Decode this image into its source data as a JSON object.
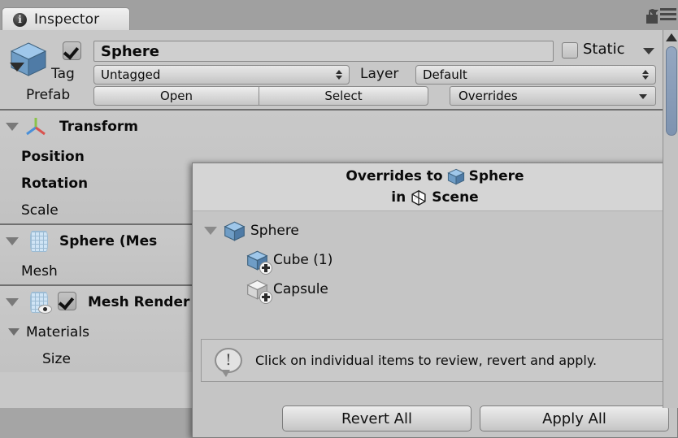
{
  "window": {
    "tab_label": "Inspector",
    "tab_icon": "info-circle-icon",
    "lock_icon": "lock-icon",
    "menu_icon": "hamburger-menu-icon"
  },
  "colors": {
    "panel_bg": "#c8c8c8",
    "popup_bg": "#c5c5c5",
    "popup_header_bg": "#d5d5d5",
    "prefab_blue": "#7fb2e0",
    "scrollbar_thumb": "#87a0bd",
    "separator": "#6f6f6f"
  },
  "object_header": {
    "icon": "prefab-cube-icon",
    "enabled_checkbox": true,
    "name_value": "Sphere",
    "name_placeholder": "Name",
    "static_label": "Static",
    "static_checked": false,
    "tag_label": "Tag",
    "tag_value": "Untagged",
    "layer_label": "Layer",
    "layer_value": "Default",
    "prefab_label": "Prefab",
    "prefab_open_label": "Open",
    "prefab_select_label": "Select",
    "prefab_overrides_label": "Overrides"
  },
  "components": [
    {
      "title": "Transform",
      "icon": "transform-axis-icon",
      "expanded": true,
      "props": [
        {
          "label": "Position",
          "bold": true
        },
        {
          "label": "Rotation",
          "bold": true
        },
        {
          "label": "Scale",
          "bold": false
        }
      ]
    },
    {
      "title": "Sphere (Mes",
      "icon": "mesh-filter-icon",
      "expanded": true,
      "props": [
        {
          "label": "Mesh",
          "bold": false
        }
      ]
    },
    {
      "title": "Mesh Render",
      "icon": "mesh-renderer-icon",
      "expanded": true,
      "enabled_checkbox": true,
      "props": [
        {
          "label": "Materials",
          "bold": false
        },
        {
          "label": "Size",
          "bold": false
        }
      ]
    }
  ],
  "overrides_popup": {
    "header_line1_prefix": "Overrides to",
    "header_line1_target": "Sphere",
    "header_line1_icon": "prefab-cube-icon",
    "header_line2_prefix": "in",
    "header_line2_target": "Scene",
    "header_line2_icon": "unity-logo-icon",
    "tree": [
      {
        "label": "Sphere",
        "icon": "prefab-cube-icon",
        "indent": 0,
        "expanded": true,
        "added": false
      },
      {
        "label": "Cube (1)",
        "icon": "prefab-cube-added-icon",
        "indent": 1,
        "expanded": false,
        "added": true
      },
      {
        "label": "Capsule",
        "icon": "gameobject-added-icon",
        "indent": 1,
        "expanded": false,
        "added": true
      }
    ],
    "info_icon": "speech-bubble-exclamation-icon",
    "info_text": "Click on individual items to review, revert and apply.",
    "revert_all_label": "Revert All",
    "apply_all_label": "Apply All"
  },
  "scrollbar": {
    "up_arrow_icon": "scroll-up-arrow-icon",
    "thumb": "scroll-thumb"
  }
}
